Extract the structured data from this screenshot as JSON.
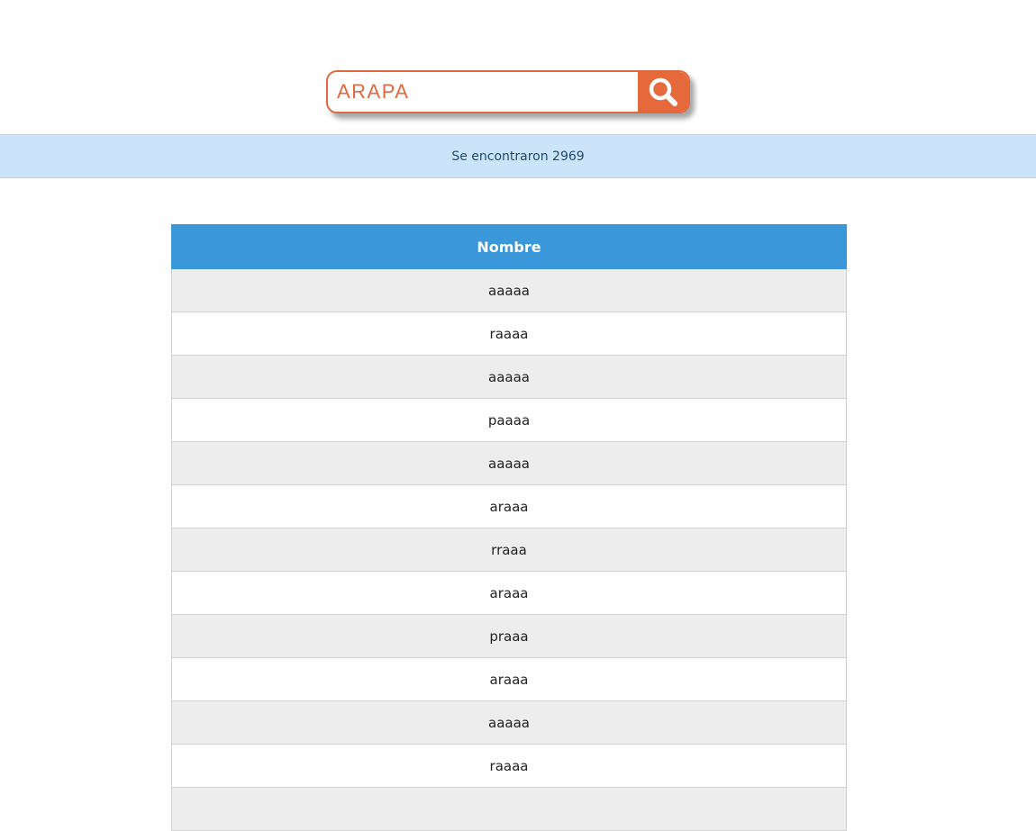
{
  "search": {
    "value": "ARAPA",
    "button_icon": "search-icon",
    "accent_color": "#e5693b"
  },
  "results": {
    "message": "Se encontraron 2969"
  },
  "table": {
    "header": "Nombre",
    "header_color": "#3a97da",
    "rows": [
      "aaaaa",
      "raaaa",
      "aaaaa",
      "paaaa",
      "aaaaa",
      "araaa",
      "rraaa",
      "araaa",
      "praaa",
      "araaa",
      "aaaaa",
      "raaaa",
      ""
    ]
  }
}
